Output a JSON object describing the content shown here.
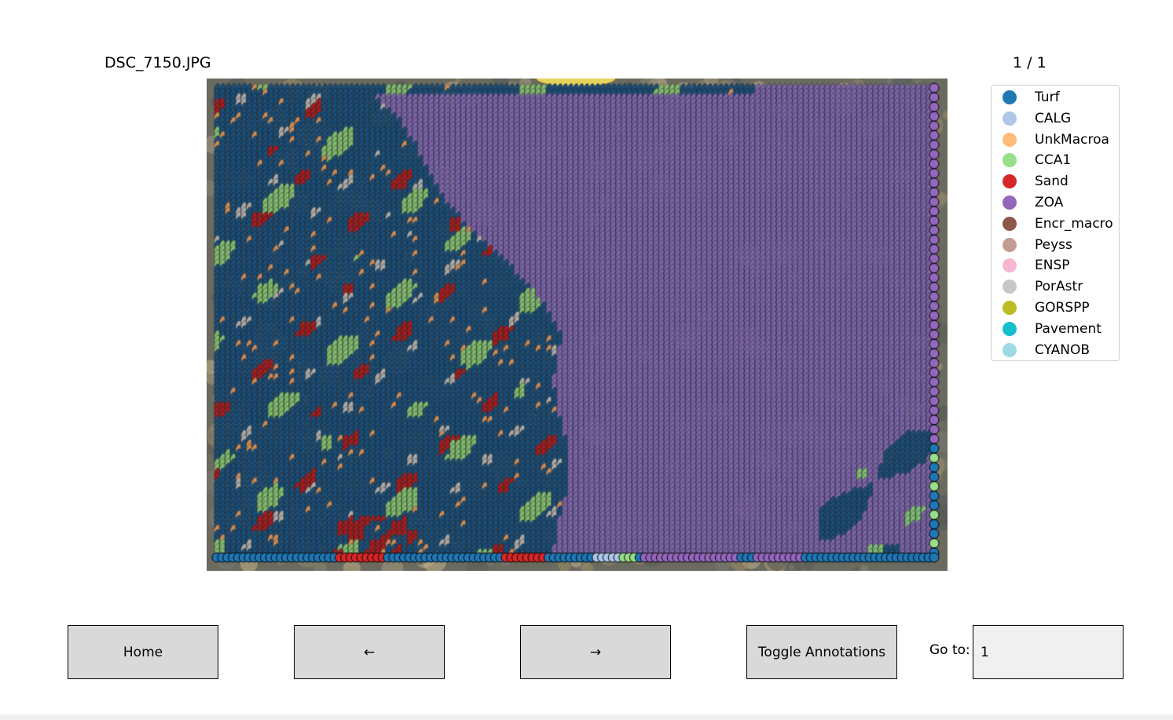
{
  "header": {
    "filename": "DSC_7150.JPG",
    "page_counter": "1 / 1"
  },
  "legend": {
    "items": [
      {
        "label": "Turf",
        "color": "#1f77b4"
      },
      {
        "label": "CALG",
        "color": "#aec7e8"
      },
      {
        "label": "UnkMacroa",
        "color": "#ffbb78"
      },
      {
        "label": "CCA1",
        "color": "#98df8a"
      },
      {
        "label": "Sand",
        "color": "#d62728"
      },
      {
        "label": "ZOA",
        "color": "#9467bd"
      },
      {
        "label": "Encr_macro",
        "color": "#8c564b"
      },
      {
        "label": "Peyss",
        "color": "#c49c94"
      },
      {
        "label": "ENSP",
        "color": "#f7b6d2"
      },
      {
        "label": "PorAstr",
        "color": "#c7c7c7"
      },
      {
        "label": "GORSPP",
        "color": "#bcbd22"
      },
      {
        "label": "Pavement",
        "color": "#17becf"
      },
      {
        "label": "CYANOB",
        "color": "#9edae5"
      }
    ]
  },
  "toolbar": {
    "home_label": "Home",
    "prev_label": "←",
    "next_label": "→",
    "toggle_label": "Toggle Annotations",
    "goto_label": "Go to:",
    "goto_value": "1"
  }
}
